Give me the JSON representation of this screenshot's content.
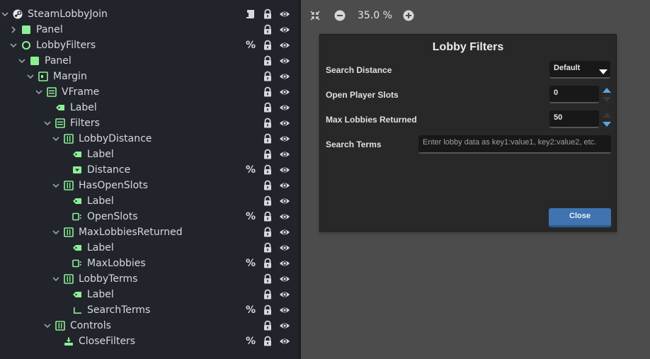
{
  "scene_tree": {
    "nodes": [
      {
        "name": "SteamLobbyJoin",
        "icon": "steam-icon",
        "script": true,
        "pct": false,
        "arrow": "down",
        "level": 0
      },
      {
        "name": "Panel",
        "icon": "panel-icon",
        "script": false,
        "pct": false,
        "arrow": "right",
        "level": 1
      },
      {
        "name": "LobbyFilters",
        "icon": "circle-control-icon",
        "script": false,
        "pct": true,
        "arrow": "down",
        "level": 1
      },
      {
        "name": "Panel",
        "icon": "panel-icon",
        "script": false,
        "pct": false,
        "arrow": "down",
        "level": 2
      },
      {
        "name": "Margin",
        "icon": "margin-container-icon",
        "script": false,
        "pct": false,
        "arrow": "down",
        "level": 3
      },
      {
        "name": "VFrame",
        "icon": "vbox-icon",
        "script": false,
        "pct": false,
        "arrow": "down",
        "level": 4
      },
      {
        "name": "Label",
        "icon": "label-icon",
        "script": false,
        "pct": false,
        "arrow": "none",
        "level": 5
      },
      {
        "name": "Filters",
        "icon": "vbox-icon",
        "script": false,
        "pct": false,
        "arrow": "down",
        "level": 5
      },
      {
        "name": "LobbyDistance",
        "icon": "hbox-icon",
        "script": false,
        "pct": false,
        "arrow": "down",
        "level": 6
      },
      {
        "name": "Label",
        "icon": "label-icon",
        "script": false,
        "pct": false,
        "arrow": "none",
        "level": 7
      },
      {
        "name": "Distance",
        "icon": "option-button-icon",
        "script": false,
        "pct": true,
        "arrow": "none",
        "level": 7
      },
      {
        "name": "HasOpenSlots",
        "icon": "hbox-icon",
        "script": false,
        "pct": false,
        "arrow": "down",
        "level": 6
      },
      {
        "name": "Label",
        "icon": "label-icon",
        "script": false,
        "pct": false,
        "arrow": "none",
        "level": 7
      },
      {
        "name": "OpenSlots",
        "icon": "spinbox-icon",
        "script": false,
        "pct": true,
        "arrow": "none",
        "level": 7
      },
      {
        "name": "MaxLobbiesReturned",
        "icon": "hbox-icon",
        "script": false,
        "pct": false,
        "arrow": "down",
        "level": 6
      },
      {
        "name": "Label",
        "icon": "label-icon",
        "script": false,
        "pct": false,
        "arrow": "none",
        "level": 7
      },
      {
        "name": "MaxLobbies",
        "icon": "spinbox-icon",
        "script": false,
        "pct": true,
        "arrow": "none",
        "level": 7
      },
      {
        "name": "LobbyTerms",
        "icon": "hbox-icon",
        "script": false,
        "pct": false,
        "arrow": "down",
        "level": 6
      },
      {
        "name": "Label",
        "icon": "label-icon",
        "script": false,
        "pct": false,
        "arrow": "none",
        "level": 7
      },
      {
        "name": "SearchTerms",
        "icon": "line-edit-icon",
        "script": false,
        "pct": true,
        "arrow": "none",
        "level": 7
      },
      {
        "name": "Controls",
        "icon": "hbox-icon",
        "script": false,
        "pct": false,
        "arrow": "down",
        "level": 5
      },
      {
        "name": "CloseFilters",
        "icon": "button-icon",
        "script": false,
        "pct": true,
        "arrow": "none",
        "level": 6
      }
    ],
    "pct_symbol": "%"
  },
  "viewport": {
    "zoom_text": "35.0 %",
    "background": "#4c4c4c"
  },
  "dialog": {
    "title": "Lobby Filters",
    "search_distance_label": "Search Distance",
    "search_distance_value": "Default",
    "open_slots_label": "Open Player Slots",
    "open_slots_value": "0",
    "max_lobbies_label": "Max Lobbies Returned",
    "max_lobbies_value": "50",
    "search_terms_label": "Search Terms",
    "search_terms_placeholder": "Enter lobby data as key1:value1, key2:value2, etc.",
    "close_label": "Close"
  },
  "colors": {
    "tree_bg": "#21252b",
    "node_icon_green": "#8eef97",
    "accent_blue": "#3f74b1",
    "spin_active": "#5ba6e0"
  }
}
